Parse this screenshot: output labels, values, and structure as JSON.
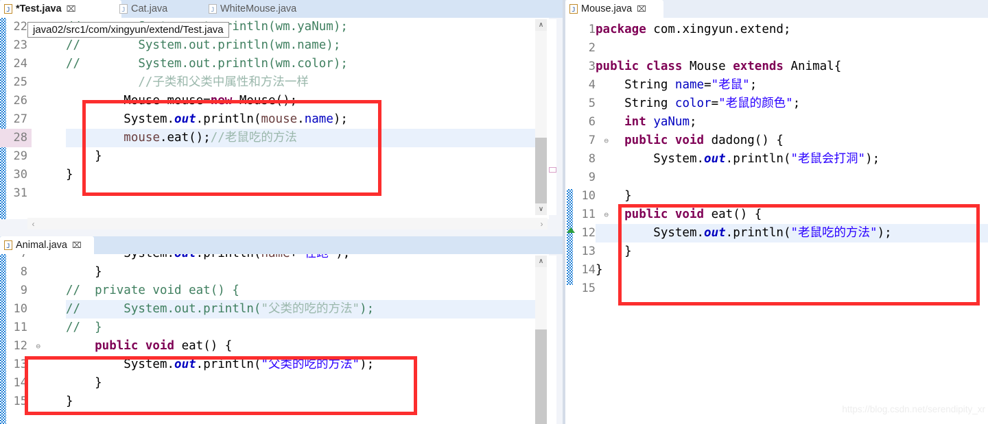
{
  "app": {
    "name": "Eclipse IDE Java editor",
    "watermark": "https://blog.csdn.net/serendipity_xr"
  },
  "tooltip": {
    "text": "java02/src1/com/xingyun/extend/Test.java"
  },
  "panels": {
    "top_left": {
      "tabs": [
        {
          "label": "*Test.java",
          "active": true,
          "close": "⌧",
          "icon": "java-file-icon"
        },
        {
          "label": "Cat.java",
          "active": false,
          "close": "⌧",
          "icon": "java-file-icon"
        },
        {
          "label": "WhiteMouse.java",
          "active": false,
          "close": "⌧",
          "icon": "java-file-icon"
        }
      ],
      "first_line": 22,
      "lines": [
        {
          "num": "22",
          "fold": "",
          "highlight": false,
          "gutter_highlight": false,
          "tokens": [
            {
              "t": "//        System.out.println(wm.yaNum);",
              "c": "cm"
            }
          ]
        },
        {
          "num": "23",
          "fold": "",
          "highlight": false,
          "gutter_highlight": false,
          "tokens": [
            {
              "t": "//        System.out.println(wm.name);",
              "c": "cm"
            }
          ]
        },
        {
          "num": "24",
          "fold": "",
          "highlight": false,
          "gutter_highlight": false,
          "tokens": [
            {
              "t": "//        System.out.println(wm.color);",
              "c": "cm"
            }
          ]
        },
        {
          "num": "25",
          "fold": "",
          "highlight": false,
          "gutter_highlight": false,
          "tokens": [
            {
              "t": "          //子类和父类中属性和方法一样",
              "c": "cm2"
            }
          ]
        },
        {
          "num": "26",
          "fold": "",
          "highlight": false,
          "gutter_highlight": false,
          "tokens": [
            {
              "t": "        Mouse mouse=",
              "c": "pl"
            },
            {
              "t": "new",
              "c": "kw"
            },
            {
              "t": " Mouse();",
              "c": "pl"
            }
          ]
        },
        {
          "num": "27",
          "fold": "",
          "highlight": false,
          "gutter_highlight": false,
          "tokens": [
            {
              "t": "        System.",
              "c": "pl"
            },
            {
              "t": "out",
              "c": "stat"
            },
            {
              "t": ".println(",
              "c": "pl"
            },
            {
              "t": "mouse",
              "c": "lv"
            },
            {
              "t": ".",
              "c": "pl"
            },
            {
              "t": "name",
              "c": "fld"
            },
            {
              "t": ");",
              "c": "pl"
            }
          ]
        },
        {
          "num": "28",
          "fold": "",
          "highlight": true,
          "gutter_highlight": true,
          "tokens": [
            {
              "t": "        ",
              "c": "pl"
            },
            {
              "t": "mouse",
              "c": "lv"
            },
            {
              "t": ".eat();",
              "c": "pl"
            },
            {
              "t": "//老鼠吃的方法",
              "c": "cm2"
            }
          ]
        },
        {
          "num": "29",
          "fold": "",
          "highlight": false,
          "gutter_highlight": false,
          "tokens": [
            {
              "t": "    }",
              "c": "pl"
            }
          ]
        },
        {
          "num": "30",
          "fold": "",
          "highlight": false,
          "gutter_highlight": false,
          "tokens": [
            {
              "t": "}",
              "c": "pl"
            }
          ]
        },
        {
          "num": "31",
          "fold": "",
          "highlight": false,
          "gutter_highlight": false,
          "tokens": [
            {
              "t": "",
              "c": "pl"
            }
          ]
        }
      ],
      "scroll": {
        "up_arrow": "∧",
        "down_arrow": "∨",
        "left_arrow": "‹",
        "right_arrow": "›"
      }
    },
    "bottom_left": {
      "tabs": [
        {
          "label": "Animal.java",
          "active": true,
          "close": "⌧",
          "icon": "java-file-icon"
        }
      ],
      "lines": [
        {
          "num": "7",
          "fold": "",
          "highlight": false,
          "gutter_highlight": false,
          "tokens": [
            {
              "t": "        System.",
              "c": "pl"
            },
            {
              "t": "out",
              "c": "stat"
            },
            {
              "t": ".println(",
              "c": "pl"
            },
            {
              "t": "name",
              "c": "lv"
            },
            {
              "t": "+",
              "c": "pl"
            },
            {
              "t": "\"在跑\"",
              "c": "str"
            },
            {
              "t": ");",
              "c": "pl"
            }
          ]
        },
        {
          "num": "8",
          "fold": "",
          "highlight": false,
          "gutter_highlight": false,
          "tokens": [
            {
              "t": "    }",
              "c": "pl"
            }
          ]
        },
        {
          "num": "9",
          "fold": "",
          "highlight": false,
          "gutter_highlight": false,
          "tokens": [
            {
              "t": "//  private void eat() {",
              "c": "cm"
            }
          ]
        },
        {
          "num": "10",
          "fold": "",
          "highlight": true,
          "gutter_highlight": false,
          "tokens": [
            {
              "t": "//      System.out.println(",
              "c": "cm"
            },
            {
              "t": "\"父类的吃的方法\"",
              "c": "cm2"
            },
            {
              "t": ");",
              "c": "cm"
            }
          ]
        },
        {
          "num": "11",
          "fold": "",
          "highlight": false,
          "gutter_highlight": false,
          "tokens": [
            {
              "t": "//  }",
              "c": "cm"
            }
          ]
        },
        {
          "num": "12",
          "fold": "⊖",
          "highlight": false,
          "gutter_highlight": false,
          "tokens": [
            {
              "t": "    public void",
              "c": "kw"
            },
            {
              "t": " eat() {",
              "c": "pl"
            }
          ]
        },
        {
          "num": "13",
          "fold": "",
          "highlight": false,
          "gutter_highlight": false,
          "tokens": [
            {
              "t": "        System.",
              "c": "pl"
            },
            {
              "t": "out",
              "c": "stat"
            },
            {
              "t": ".println(",
              "c": "pl"
            },
            {
              "t": "\"父类的吃的方法\"",
              "c": "str"
            },
            {
              "t": ");",
              "c": "pl"
            }
          ]
        },
        {
          "num": "14",
          "fold": "",
          "highlight": false,
          "gutter_highlight": false,
          "tokens": [
            {
              "t": "    }",
              "c": "pl"
            }
          ]
        },
        {
          "num": "15",
          "fold": "",
          "highlight": false,
          "gutter_highlight": false,
          "tokens": [
            {
              "t": "}",
              "c": "pl"
            }
          ]
        }
      ],
      "scroll": {
        "up_arrow": "∧",
        "down_arrow": "∨"
      }
    },
    "right": {
      "tabs": [
        {
          "label": "Mouse.java",
          "active": true,
          "close": "⌧",
          "icon": "java-file-icon"
        }
      ],
      "lines": [
        {
          "num": "1",
          "fold": "",
          "highlight": false,
          "gutter_highlight": false,
          "tokens": [
            {
              "t": "package",
              "c": "kw"
            },
            {
              "t": " com.xingyun.extend;",
              "c": "pl"
            }
          ]
        },
        {
          "num": "2",
          "fold": "",
          "highlight": false,
          "gutter_highlight": false,
          "tokens": [
            {
              "t": "",
              "c": "pl"
            }
          ]
        },
        {
          "num": "3",
          "fold": "",
          "highlight": false,
          "gutter_highlight": false,
          "tokens": [
            {
              "t": "public class",
              "c": "kw"
            },
            {
              "t": " Mouse ",
              "c": "pl"
            },
            {
              "t": "extends",
              "c": "kw"
            },
            {
              "t": " Animal{",
              "c": "pl"
            }
          ]
        },
        {
          "num": "4",
          "fold": "",
          "highlight": false,
          "gutter_highlight": false,
          "tokens": [
            {
              "t": "    String ",
              "c": "pl"
            },
            {
              "t": "name",
              "c": "fld"
            },
            {
              "t": "=",
              "c": "pl"
            },
            {
              "t": "\"老鼠\"",
              "c": "str"
            },
            {
              "t": ";",
              "c": "pl"
            }
          ]
        },
        {
          "num": "5",
          "fold": "",
          "highlight": false,
          "gutter_highlight": false,
          "tokens": [
            {
              "t": "    String ",
              "c": "pl"
            },
            {
              "t": "color",
              "c": "fld"
            },
            {
              "t": "=",
              "c": "pl"
            },
            {
              "t": "\"老鼠的颜色\"",
              "c": "str"
            },
            {
              "t": ";",
              "c": "pl"
            }
          ]
        },
        {
          "num": "6",
          "fold": "",
          "highlight": false,
          "gutter_highlight": false,
          "tokens": [
            {
              "t": "    int",
              "c": "kw"
            },
            {
              "t": " ",
              "c": "pl"
            },
            {
              "t": "yaNum",
              "c": "fld"
            },
            {
              "t": ";",
              "c": "pl"
            }
          ]
        },
        {
          "num": "7",
          "fold": "⊖",
          "highlight": false,
          "gutter_highlight": false,
          "tokens": [
            {
              "t": "    public void",
              "c": "kw"
            },
            {
              "t": " dadong() {",
              "c": "pl"
            }
          ]
        },
        {
          "num": "8",
          "fold": "",
          "highlight": false,
          "gutter_highlight": false,
          "tokens": [
            {
              "t": "        System.",
              "c": "pl"
            },
            {
              "t": "out",
              "c": "stat"
            },
            {
              "t": ".println(",
              "c": "pl"
            },
            {
              "t": "\"老鼠会打洞\"",
              "c": "str"
            },
            {
              "t": ");",
              "c": "pl"
            }
          ]
        },
        {
          "num": "9",
          "fold": "",
          "highlight": false,
          "gutter_highlight": false,
          "tokens": [
            {
              "t": "",
              "c": "pl"
            }
          ]
        },
        {
          "num": "10",
          "fold": "",
          "highlight": false,
          "gutter_highlight": false,
          "tokens": [
            {
              "t": "    }",
              "c": "pl"
            }
          ]
        },
        {
          "num": "11",
          "fold": "⊖",
          "highlight": false,
          "gutter_highlight": false,
          "marker": "green-triangle",
          "tokens": [
            {
              "t": "    public void",
              "c": "kw"
            },
            {
              "t": " eat() {",
              "c": "pl"
            }
          ]
        },
        {
          "num": "12",
          "fold": "",
          "highlight": true,
          "gutter_highlight": false,
          "tokens": [
            {
              "t": "        System.",
              "c": "pl"
            },
            {
              "t": "out",
              "c": "stat"
            },
            {
              "t": ".println(",
              "c": "pl"
            },
            {
              "t": "\"老鼠吃的方法\"",
              "c": "str"
            },
            {
              "t": ");",
              "c": "pl"
            }
          ]
        },
        {
          "num": "13",
          "fold": "",
          "highlight": false,
          "gutter_highlight": false,
          "tokens": [
            {
              "t": "    }",
              "c": "pl"
            }
          ]
        },
        {
          "num": "14",
          "fold": "",
          "highlight": false,
          "gutter_highlight": false,
          "tokens": [
            {
              "t": "}",
              "c": "pl"
            }
          ]
        },
        {
          "num": "15",
          "fold": "",
          "highlight": false,
          "gutter_highlight": false,
          "tokens": [
            {
              "t": "",
              "c": "pl"
            }
          ]
        }
      ]
    }
  },
  "annotations": [
    {
      "name": "redbox-test-java",
      "note": "highlights Mouse instantiation and eat() call"
    },
    {
      "name": "redbox-animal-java",
      "note": "highlights parent class eat() method"
    },
    {
      "name": "redbox-mouse-java",
      "note": "highlights overriding eat() method"
    }
  ],
  "colors": {
    "annotation_red": "#FC2E2E",
    "keyword": "#7F0055",
    "string": "#2A00FF",
    "comment": "#3F7F5F",
    "field": "#0000C0",
    "local_var": "#6A3E3E",
    "line_highlight": "#E9F1FC",
    "gutter_highlight": "#EFDDEA",
    "tab_background": "#D6E4F5"
  }
}
